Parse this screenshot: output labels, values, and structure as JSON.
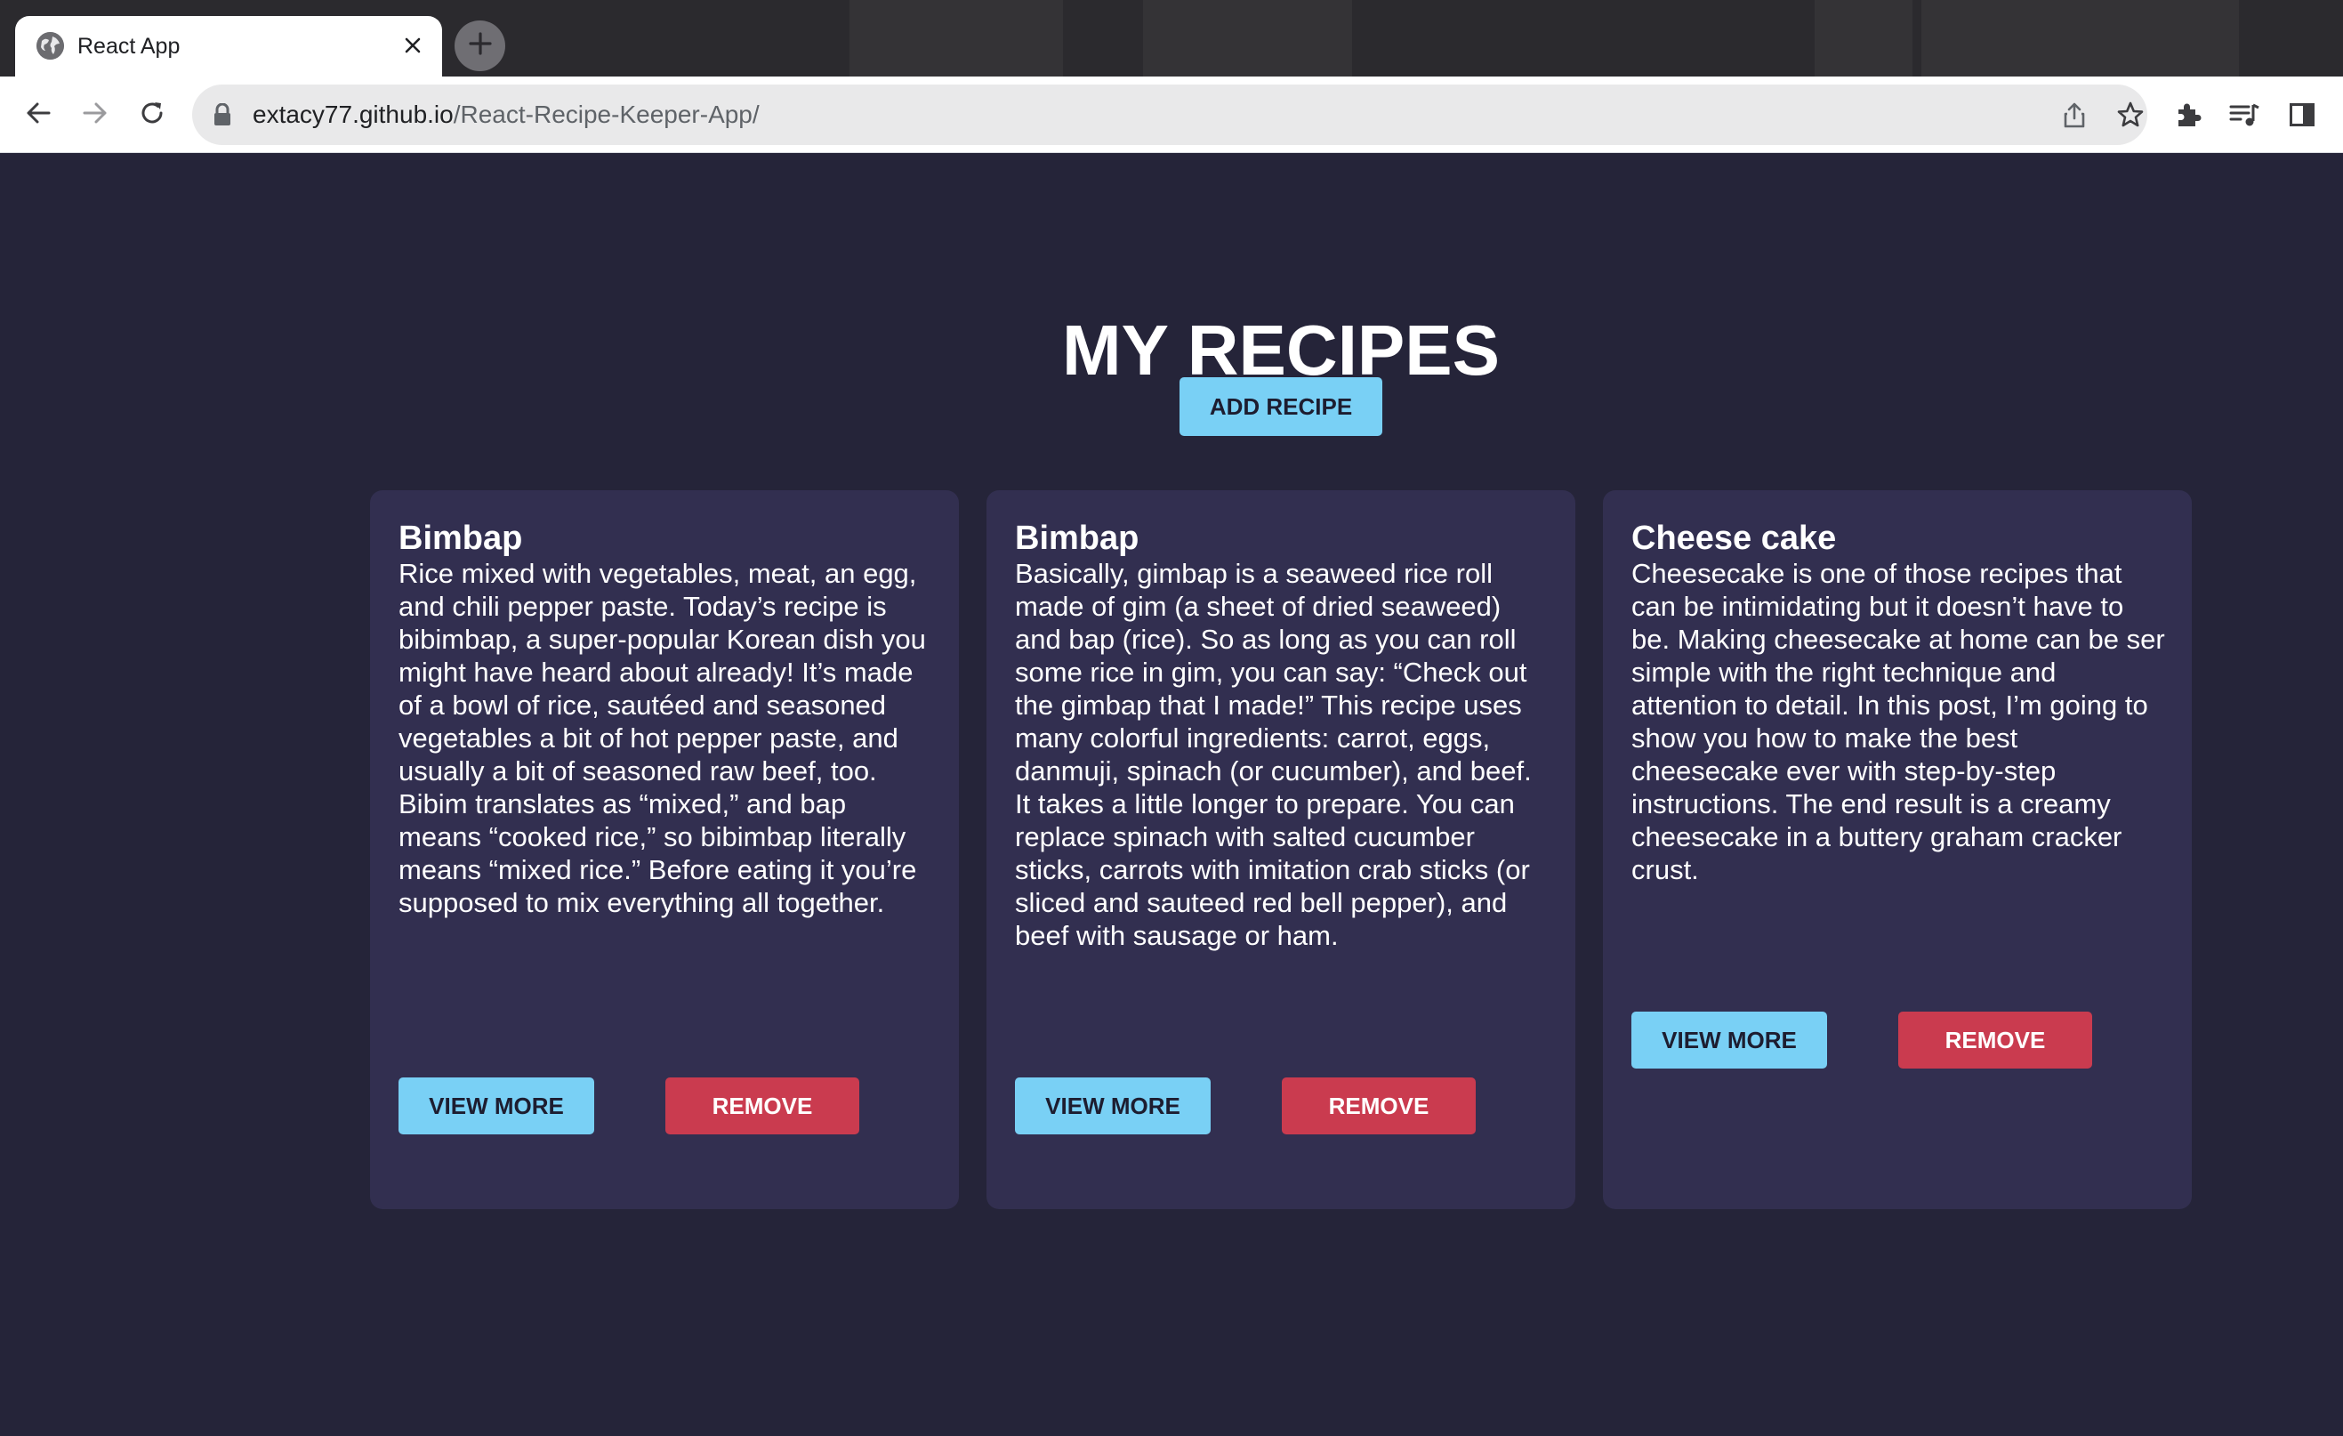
{
  "browser": {
    "tab_title": "React App",
    "url_domain": "extacy77.github.io",
    "url_path": "/React-Recipe-Keeper-App/",
    "icons": {
      "favicon": "globe-icon",
      "close": "close-icon",
      "new_tab": "plus-icon",
      "back": "arrow-left-icon",
      "forward": "arrow-right-icon",
      "reload": "reload-icon",
      "lock": "lock-icon",
      "share": "share-icon",
      "bookmark": "star-icon",
      "extensions": "puzzle-icon",
      "media": "media-queue-icon",
      "side_panel": "side-panel-icon"
    }
  },
  "page": {
    "title": "MY RECIPES",
    "add_button_label": "ADD RECIPE",
    "colors": {
      "background": "#252439",
      "card": "#322f50",
      "primary_button": "#79d0f5",
      "danger_button": "#ca3b4f"
    },
    "recipes": [
      {
        "title": "Bimbap",
        "description": "Rice mixed with vegetables, meat, an egg, and chili pepper paste. Today’s recipe is bibimbap, a super-popular Korean dish you might have heard about already! It’s made of a bowl of rice, sautéed and seasoned vegetables a bit of hot pepper paste, and usually a bit of seasoned raw beef, too. Bibim translates as “mixed,” and bap means “cooked rice,” so bibimbap literally means “mixed rice.” Before eating it you’re supposed to mix everything all together.",
        "view_label": "VIEW MORE",
        "remove_label": "REMOVE"
      },
      {
        "title": "Bimbap",
        "description": "Basically, gimbap is a seaweed rice roll made of gim (a sheet of dried seaweed) and bap (rice). So as long as you can roll some rice in gim, you can say: “Check out the gimbap that I made!” This recipe uses many colorful ingredients: carrot, eggs, danmuji, spinach (or cucumber), and beef. It takes a little longer to prepare. You can replace spinach with salted cucumber sticks, carrots with imitation crab sticks (or sliced and sauteed red bell pepper), and beef with sausage or ham.",
        "view_label": "VIEW MORE",
        "remove_label": "REMOVE"
      },
      {
        "title": "Cheese cake",
        "description": "Cheesecake is one of those recipes that can be intimidating but it doesn’t have to be. Making cheesecake at home can be ser simple with the right technique and attention to detail. In this post, I’m going to show you how to make the best cheesecake ever with step-by-step instructions. The end result is a creamy cheesecake in a buttery graham cracker crust.",
        "view_label": "VIEW MORE",
        "remove_label": "REMOVE"
      }
    ]
  }
}
